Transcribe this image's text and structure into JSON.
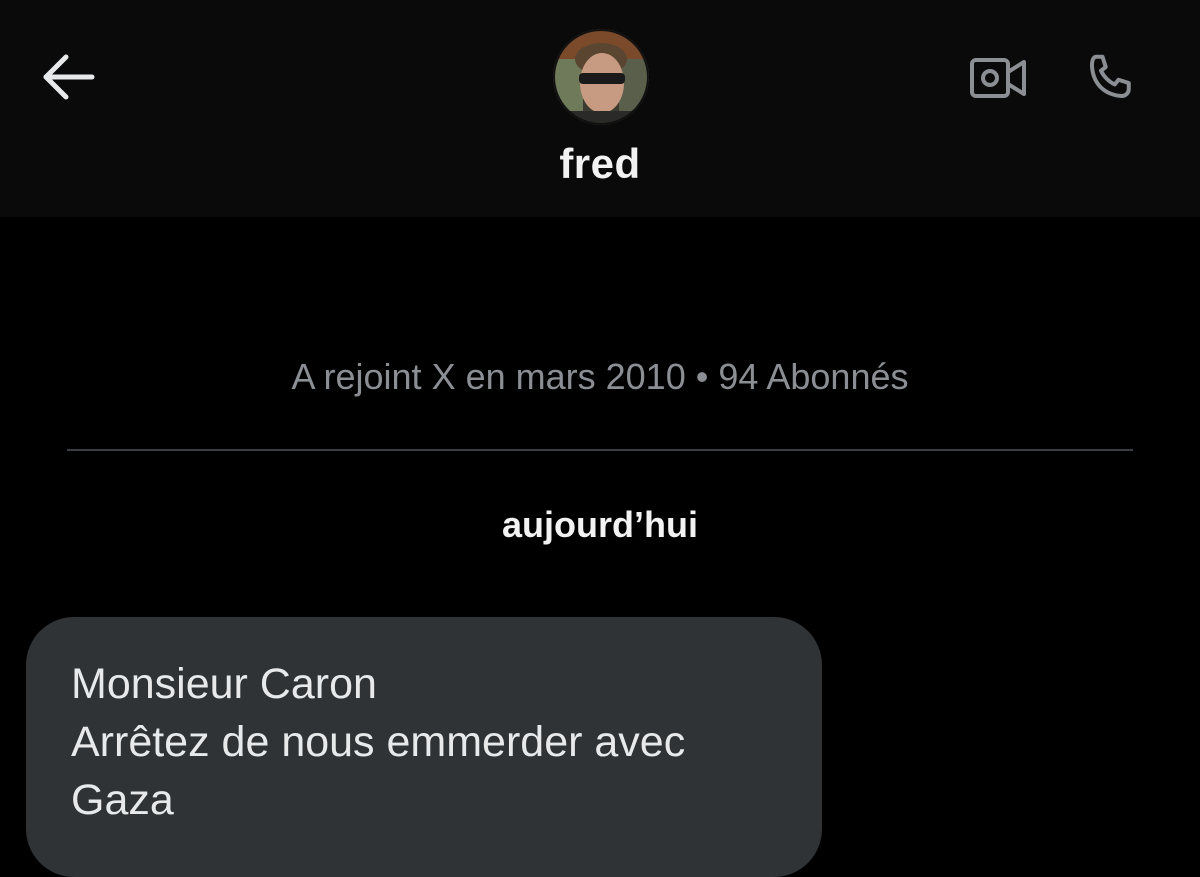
{
  "header": {
    "contact_name": "fred",
    "icons": {
      "back": "arrow-left-icon",
      "video": "video-camera-icon",
      "call": "phone-icon"
    },
    "icon_color": "#8b8f93"
  },
  "profile": {
    "meta": "A rejoint X en mars 2010 • 94 Abonnés"
  },
  "conversation": {
    "date_label": "aujourd’hui",
    "messages": [
      {
        "lines": [
          "Monsieur Caron",
          "Arrêtez de nous emmerder avec",
          "Gaza"
        ]
      }
    ]
  },
  "colors": {
    "background": "#000000",
    "header_background": "#0a0a0a",
    "bubble": "#2f3336",
    "secondary_text": "#8b8f93",
    "primary_text": "#e7e9ea"
  }
}
